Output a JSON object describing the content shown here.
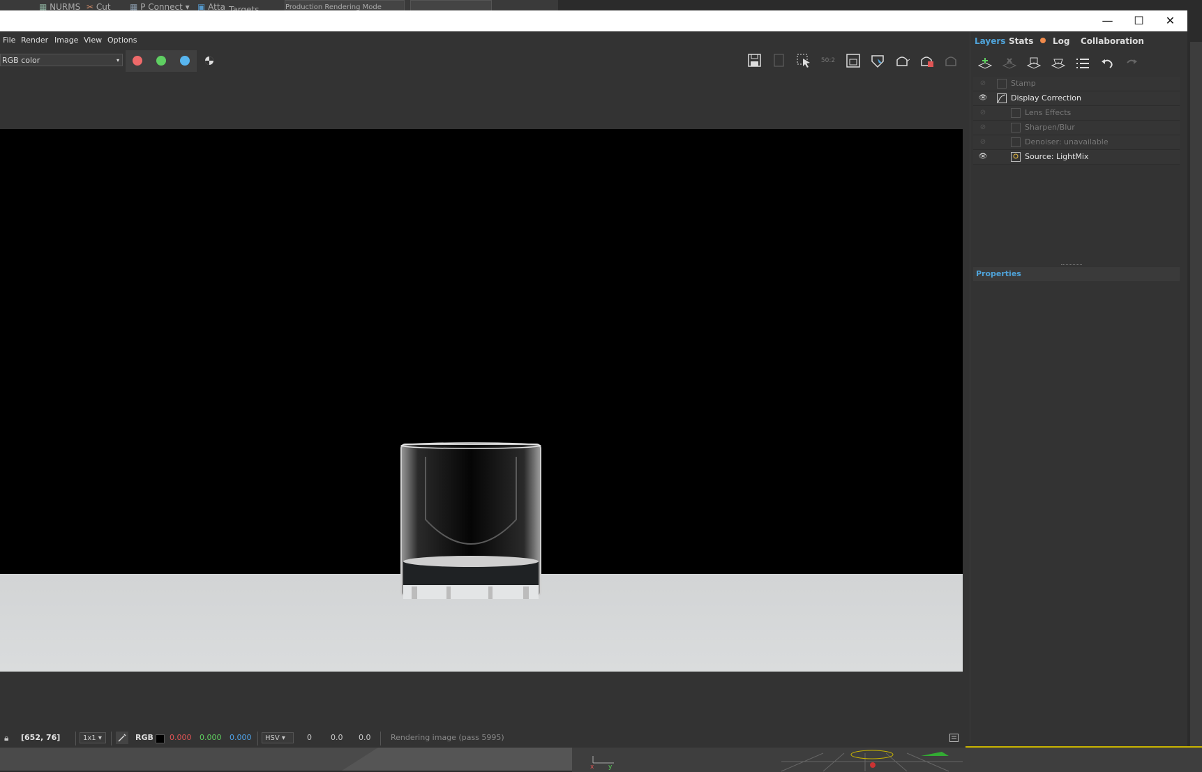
{
  "host": {
    "top_items": [
      "NURMS",
      "Cut",
      "P Connect",
      "Atta",
      "Targets",
      "Production Rendering Mode"
    ]
  },
  "window": {
    "menu": [
      "File",
      "Render",
      "Image",
      "View",
      "Options"
    ],
    "controls": {
      "minimize": "—",
      "maximize": "☐",
      "close": "✕"
    }
  },
  "toolbar": {
    "channel": "RGB color",
    "channel_dots": {
      "red": "#ef6a6a",
      "green": "#5fcf62",
      "blue": "#58b6f0"
    },
    "zoom_badge": "50:2"
  },
  "viewport": {
    "scene": "glass tumbler on white floor, black background"
  },
  "statusbar": {
    "coords": "[652, 76]",
    "scale": "1x1",
    "rgb_label": "RGB",
    "r": "0.000",
    "g": "0.000",
    "b": "0.000",
    "color_mode": "HSV",
    "h": "0",
    "s": "0.0",
    "v": "0.0",
    "status": "Rendering image (pass 5995)"
  },
  "panel": {
    "tabs": [
      "Layers",
      "Stats",
      "Log",
      "Collaboration"
    ],
    "layers": [
      {
        "name": "Stamp",
        "visible": false,
        "enabled": false
      },
      {
        "name": "Display Correction",
        "visible": true,
        "enabled": true
      },
      {
        "name": "Lens Effects",
        "visible": false,
        "enabled": false
      },
      {
        "name": "Sharpen/Blur",
        "visible": false,
        "enabled": false
      },
      {
        "name": "Denoiser: unavailable",
        "visible": false,
        "enabled": false
      },
      {
        "name": "Source: LightMix",
        "visible": true,
        "enabled": true
      }
    ],
    "properties_title": "Properties"
  },
  "colors": {
    "accent": "#4fa3d9",
    "log_dot": "#f08a4b",
    "statusbar_r": "#e05555",
    "statusbar_g": "#5fd05f",
    "statusbar_b": "#4fa3e8"
  }
}
